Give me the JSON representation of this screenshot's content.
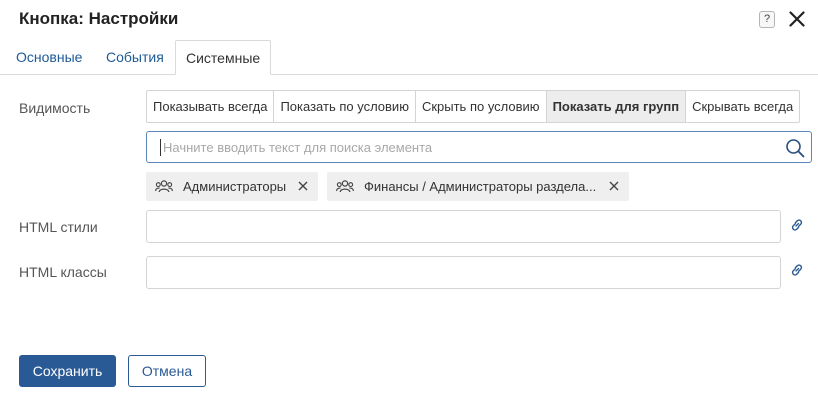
{
  "dialog": {
    "title": "Кнопка: Настройки",
    "help_label": "?",
    "close_icon": "close-icon"
  },
  "tabs": [
    {
      "label": "Основные",
      "active": false
    },
    {
      "label": "События",
      "active": false
    },
    {
      "label": "Системные",
      "active": true
    }
  ],
  "visibility": {
    "label": "Видимость",
    "options": [
      {
        "label": "Показывать всегда",
        "active": false
      },
      {
        "label": "Показать по условию",
        "active": false
      },
      {
        "label": "Скрыть по условию",
        "active": false
      },
      {
        "label": "Показать для групп",
        "active": true
      },
      {
        "label": "Скрывать всегда",
        "active": false
      }
    ],
    "search": {
      "value": "",
      "placeholder": "Начните вводить текст для поиска элемента",
      "icon": "search-icon"
    },
    "groups": [
      {
        "label": "Администраторы",
        "icon": "group-icon"
      },
      {
        "label": "Финансы / Администраторы раздела...",
        "icon": "group-icon"
      }
    ]
  },
  "html_styles": {
    "label": "HTML стили",
    "value": "",
    "icon": "link-icon"
  },
  "html_classes": {
    "label": "HTML классы",
    "value": "",
    "icon": "link-icon"
  },
  "actions": {
    "save_label": "Сохранить",
    "cancel_label": "Отмена"
  },
  "colors": {
    "accent": "#2a5a95",
    "link": "#1f5a96",
    "active_segment": "#ededed",
    "chip_bg": "#efefef"
  }
}
